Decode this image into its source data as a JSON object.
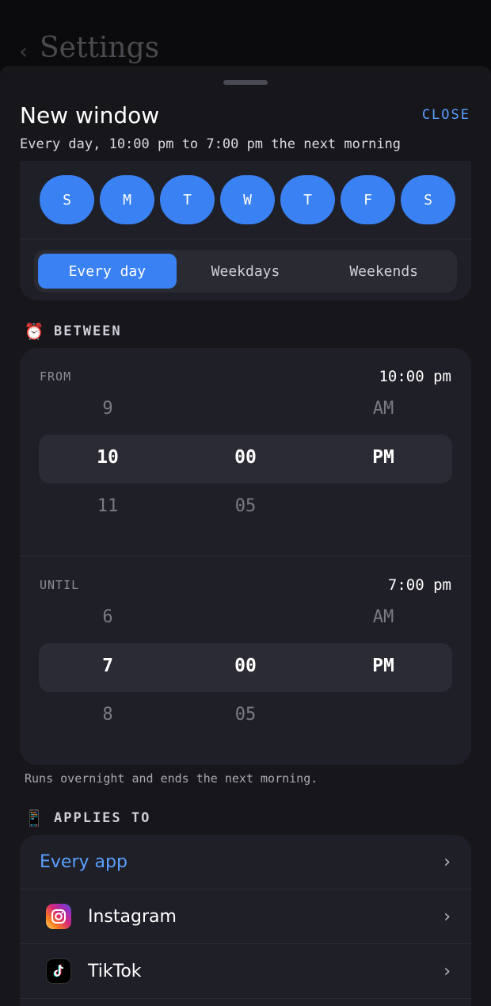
{
  "background": {
    "back_glyph": "‹",
    "title": "Settings"
  },
  "sheet": {
    "title": "New window",
    "close_label": "CLOSE",
    "subtitle": "Every day, 10:00 pm to 7:00 pm the next morning"
  },
  "days": {
    "items": [
      "S",
      "M",
      "T",
      "W",
      "T",
      "F",
      "S"
    ],
    "selected": [
      true,
      true,
      true,
      true,
      true,
      true,
      true
    ]
  },
  "presets": {
    "items": [
      "Every day",
      "Weekdays",
      "Weekends"
    ],
    "active": "Every day"
  },
  "between": {
    "emoji": "⏰",
    "label": "BETWEEN",
    "from": {
      "label": "FROM",
      "value": "10:00 pm",
      "above": [
        "9",
        "",
        "AM"
      ],
      "selected": [
        "10",
        "00",
        "PM"
      ],
      "below": [
        "11",
        "05",
        ""
      ]
    },
    "until": {
      "label": "UNTIL",
      "value": "7:00 pm",
      "above": [
        "6",
        "",
        "AM"
      ],
      "selected": [
        "7",
        "00",
        "PM"
      ],
      "below": [
        "8",
        "05",
        ""
      ]
    },
    "note": "Runs overnight and ends the next morning."
  },
  "applies": {
    "emoji": "📱",
    "label": "APPLIES TO",
    "every_app": "Every app",
    "apps": [
      {
        "name": "Instagram",
        "icon": "instagram-icon"
      },
      {
        "name": "TikTok",
        "icon": "tiktok-icon"
      }
    ],
    "chevron": "›"
  },
  "colors": {
    "accent": "#3a82f4",
    "link": "#5aa0ff",
    "sheet_bg": "#16161b",
    "card_bg": "#1f1f27"
  }
}
